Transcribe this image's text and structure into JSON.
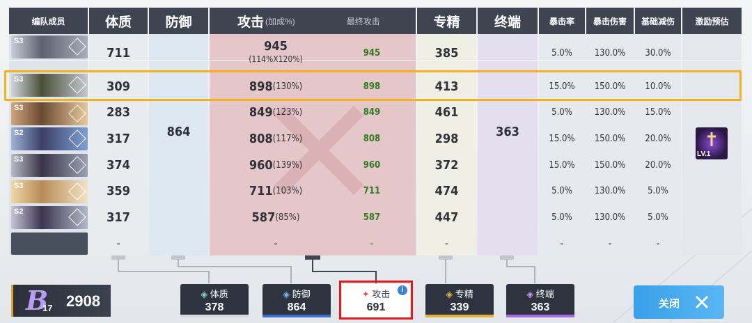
{
  "headers": {
    "member": "编队成员",
    "con": "体质",
    "def": "防御",
    "atk": "攻击",
    "atk_sub": "(加成%)",
    "final_atk": "最终攻击",
    "mastery": "专精",
    "terminal": "终端",
    "crit_rate": "暴击率",
    "crit_dmg": "暴击伤害",
    "base_reduce": "基础减伤",
    "incentive": "激励预估"
  },
  "members": [
    {
      "tier": "S3",
      "con": "711",
      "atk": "945",
      "atk_note": "(114%X120%)",
      "final": "945",
      "mastery": "385",
      "crit_rate": "5.0%",
      "crit_dmg": "130.0%",
      "reduce": "30.0%"
    },
    {
      "tier": "S3",
      "con": "309",
      "atk": "898",
      "atk_note": "(130%)",
      "final": "898",
      "mastery": "413",
      "crit_rate": "15.0%",
      "crit_dmg": "150.0%",
      "reduce": "10.0%"
    },
    {
      "tier": "S3",
      "con": "283",
      "atk": "849",
      "atk_note": "(123%)",
      "final": "849",
      "mastery": "461",
      "crit_rate": "5.0%",
      "crit_dmg": "130.0%",
      "reduce": "15.0%"
    },
    {
      "tier": "S2",
      "con": "317",
      "atk": "808",
      "atk_note": "(117%)",
      "final": "808",
      "mastery": "298",
      "crit_rate": "15.0%",
      "crit_dmg": "150.0%",
      "reduce": "20.0%"
    },
    {
      "tier": "S3",
      "con": "374",
      "atk": "960",
      "atk_note": "(139%)",
      "final": "960",
      "mastery": "372",
      "crit_rate": "15.0%",
      "crit_dmg": "150.0%",
      "reduce": "20.0%"
    },
    {
      "tier": "S3",
      "con": "359",
      "atk": "711",
      "atk_note": "(103%)",
      "final": "711",
      "mastery": "474",
      "crit_rate": "5.0%",
      "crit_dmg": "130.0%",
      "reduce": "5.0%"
    },
    {
      "tier": "S2",
      "con": "317",
      "atk": "587",
      "atk_note": "(85%)",
      "final": "587",
      "mastery": "447",
      "crit_rate": "5.0%",
      "crit_dmg": "130.0%",
      "reduce": "5.0%"
    }
  ],
  "empty_row": {
    "con": "-",
    "atk": "-",
    "final": "-",
    "mastery": "-",
    "crit_rate": "-",
    "crit_dmg": "-",
    "reduce": "-"
  },
  "shared_def": "864",
  "shared_terminal": "363",
  "incentive_badge": "LV.1",
  "level": {
    "tier": "B",
    "sub": "17",
    "score": "2908"
  },
  "tabs": [
    {
      "label": "体质",
      "value": "378",
      "color": "#d7d9dd"
    },
    {
      "label": "防御",
      "value": "864",
      "color": "#3b6fc8"
    },
    {
      "label": "攻击",
      "value": "691",
      "color": "#d9534f"
    },
    {
      "label": "专精",
      "value": "339",
      "color": "#e0b33c"
    },
    {
      "label": "终端",
      "value": "363",
      "color": "#a66be0"
    }
  ],
  "close_label": "关闭",
  "colors": {
    "header": "#3f4451",
    "selection": "#f3b21b",
    "final_atk": "#2f7a1f"
  }
}
